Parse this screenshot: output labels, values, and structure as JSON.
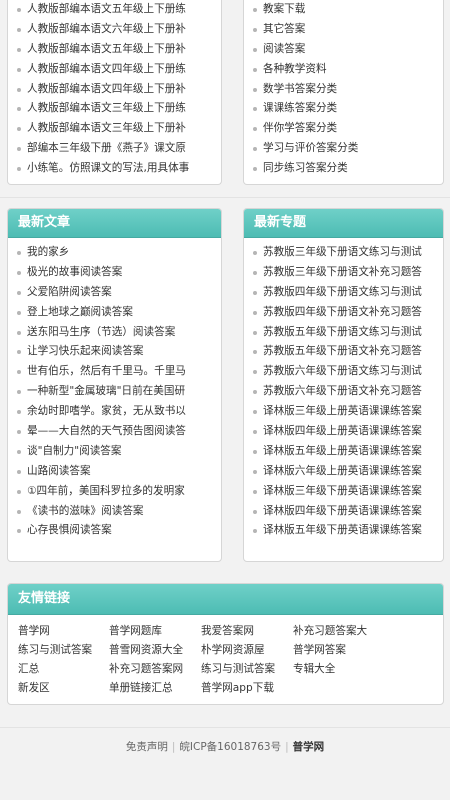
{
  "top_left": {
    "items": [
      "人教版部编本语文五年级上下册练",
      "人教版部编本语文六年级上下册补",
      "人教版部编本语文五年级上下册补",
      "人教版部编本语文四年级上下册练",
      "人教版部编本语文四年级上下册补",
      "人教版部编本语文三年级上下册练",
      "人教版部编本语文三年级上下册补",
      "部编本三年级下册《燕子》课文原",
      "小练笔。仿照课文的写法,用具体事"
    ]
  },
  "top_right": {
    "items": [
      "教案下载",
      "其它答案",
      "阅读答案",
      "各种教学资料",
      "数学书答案分类",
      "课课练答案分类",
      "伴你学答案分类",
      "学习与评价答案分类",
      "同步练习答案分类"
    ]
  },
  "latest_articles": {
    "title": "最新文章",
    "items": [
      "我的家乡",
      "极光的故事阅读答案",
      "父爱陷阱阅读答案",
      "登上地球之巅阅读答案",
      "送东阳马生序（节选）阅读答案",
      "让学习快乐起来阅读答案",
      "世有伯乐，然后有千里马。千里马",
      "一种新型\"金属玻璃\"日前在美国研",
      "余幼时即嗜学。家贫，无从致书以",
      "晕——大自然的天气预告图阅读答",
      "谈\"自制力\"阅读答案",
      "山路阅读答案",
      "①四年前，美国科罗拉多的发明家",
      "《读书的滋味》阅读答案",
      "心存畏惧阅读答案"
    ]
  },
  "latest_topics": {
    "title": "最新专题",
    "items": [
      "苏教版三年级下册语文练习与测试",
      "苏教版三年级下册语文补充习题答",
      "苏教版四年级下册语文练习与测试",
      "苏教版四年级下册语文补充习题答",
      "苏教版五年级下册语文练习与测试",
      "苏教版五年级下册语文补充习题答",
      "苏教版六年级下册语文练习与测试",
      "苏教版六年级下册语文补充习题答",
      "译林版三年级上册英语课课练答案",
      "译林版四年级上册英语课课练答案",
      "译林版五年级上册英语课课练答案",
      "译林版六年级上册英语课课练答案",
      "译林版三年级下册英语课课练答案",
      "译林版四年级下册英语课课练答案",
      "译林版五年级下册英语课课练答案"
    ]
  },
  "friend_links": {
    "title": "友情链接",
    "items": [
      "普学网",
      "普学网题库",
      "我爱答案网",
      "补充习题答案大",
      "练习与测试答案",
      "普雪网资源大全",
      "朴学网资源屋",
      "普学网答案",
      "汇总",
      "补充习题答案网",
      "练习与测试答案",
      "专辑大全",
      "新发区",
      "单册链接汇总",
      "普学网app下载",
      ""
    ]
  },
  "footer": {
    "disclaimer": "免责声明",
    "icp": "皖ICP备16018763号",
    "brand": "普学网"
  },
  "colors": {
    "header_bg": "#4dbcb3",
    "header_text": "#ffffff",
    "page_bg": "#f2f2f2"
  }
}
